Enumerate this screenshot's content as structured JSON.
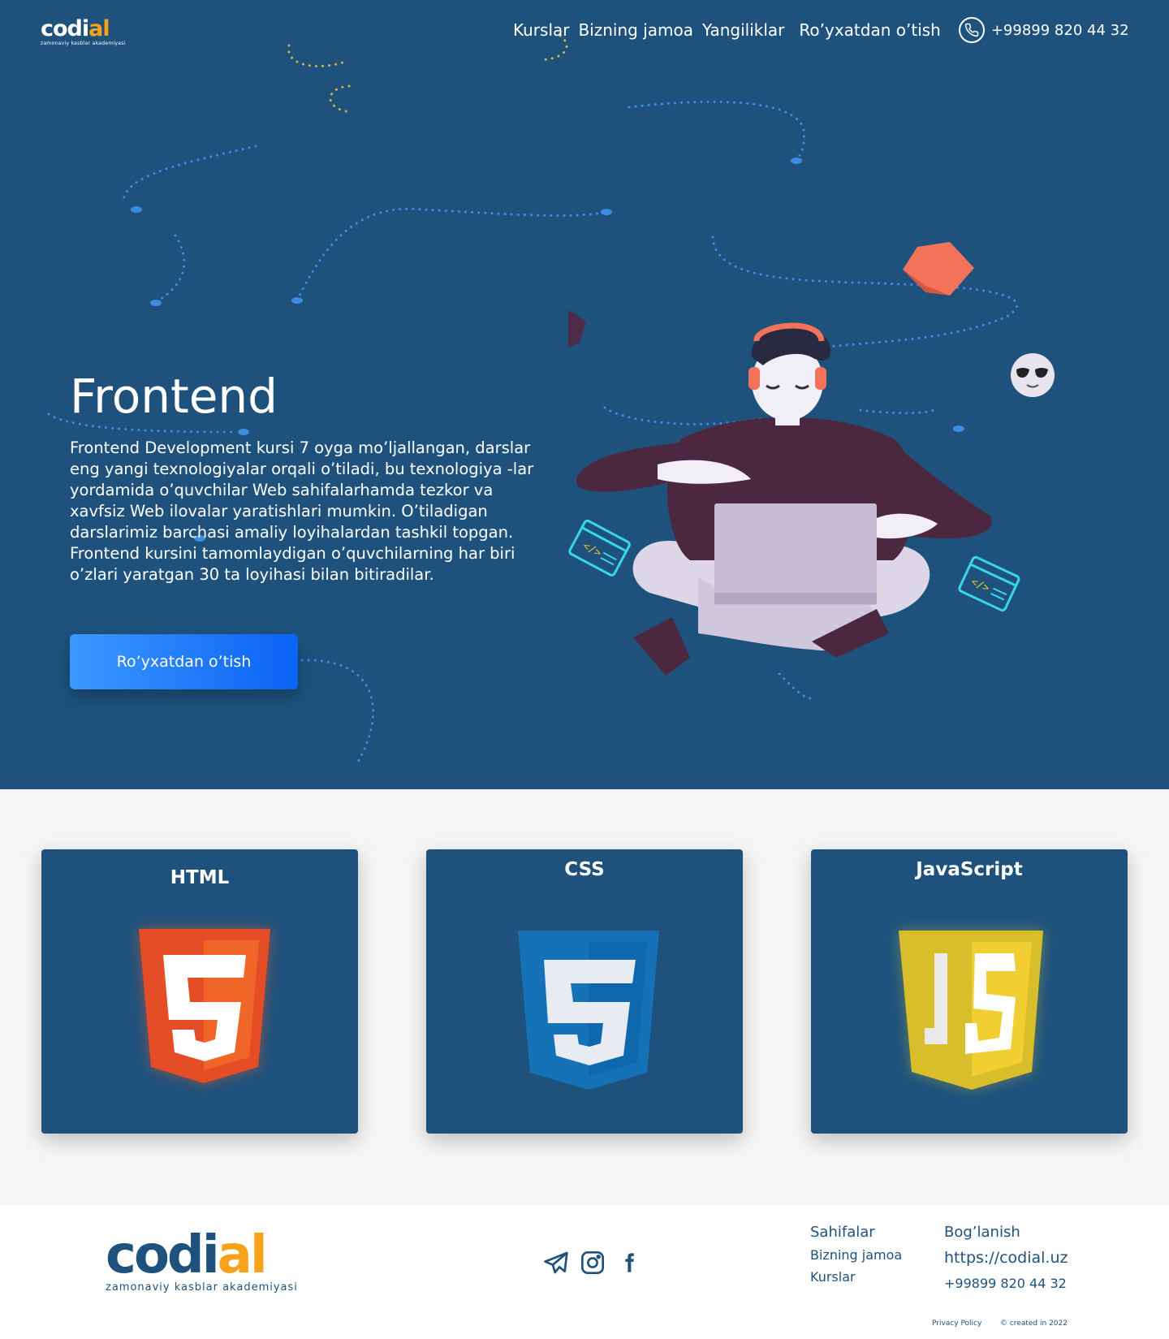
{
  "brand": {
    "name_start": "codi",
    "name_accent": "al",
    "tagline": "zamonaviy kasblar akademiyasi",
    "accent_color": "#f7a21b",
    "primary_color": "#1e527d"
  },
  "nav": {
    "items": [
      "Kurslar",
      "Bizning jamoa",
      "Yangiliklar",
      "Ro’yxatdan o’tish"
    ],
    "phone": "+99899 820 44 32",
    "phone_icon": "phone-icon"
  },
  "hero": {
    "title": "Frontend",
    "description": "Frontend Development kursi 7 oyga mo’ljallangan, darslar eng yangi texnologiyalar orqali o’tiladi, bu texnologiya -lar yordamida o’quvchilar Web sahifalarhamda tezkor va xavfsiz Web ilovalar yaratishlari mumkin. O’tiladigan darslarimiz barchasi amaliy loyihalardan tashkil topgan. Frontend kursini tamomlaydigan o’quvchilarning har biri o’zlari yaratgan 30 ta loyihasi bilan bitiradilar.",
    "cta_label": "Ro’yxatdan o’tish",
    "illustration": "developer-with-laptop-illustration"
  },
  "cards": [
    {
      "title": "HTML",
      "icon": "html5-icon",
      "color": "#e44d26"
    },
    {
      "title": "CSS",
      "icon": "css3-icon",
      "color": "#1572b6"
    },
    {
      "title": "JavaScript",
      "icon": "javascript-icon",
      "color": "#e8c52a"
    }
  ],
  "footer": {
    "socials": [
      "telegram-icon",
      "instagram-icon",
      "facebook-icon"
    ],
    "col1": {
      "heading": "Sahifalar",
      "links": [
        "Bizning jamoa",
        "Kurslar"
      ]
    },
    "col2": {
      "heading": "Bog’lanish",
      "website": "https://codial.uz",
      "phone": "+99899 820 44 32"
    },
    "privacy": "Privacy Policy",
    "copyright": "© created in 2022"
  }
}
